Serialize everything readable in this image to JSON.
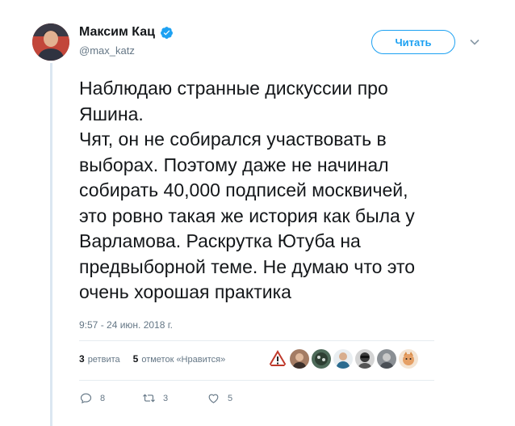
{
  "author": {
    "display_name": "Максим Кац",
    "handle": "@max_katz",
    "verified": true,
    "avatar_icon": "user-avatar-icon"
  },
  "follow_button": {
    "label": "Читать"
  },
  "tweet": {
    "lines": [
      "Наблюдаю странные дискуссии про",
      "Яшина.",
      "Чят, он не собирался участвовать в",
      "выборах. Поэтому даже не начинал",
      "собирать 40,000 подписей москвичей,",
      "это ровно такая же история как была у",
      "Варламова. Раскрутка Ютуба на",
      "предвыборной теме. Не думаю что это",
      "очень хорошая практика"
    ],
    "timestamp": "9:57 - 24 июн. 2018 г."
  },
  "stats": {
    "retweets_count": "3",
    "retweets_label": "ретвита",
    "likes_count": "5",
    "likes_label": "отметок «Нравится»"
  },
  "actions": {
    "reply_count": "8",
    "retweet_count": "3",
    "like_count": "5"
  },
  "colors": {
    "accent": "#1da1f2",
    "muted": "#657786",
    "text": "#14171a",
    "thread_line": "#dbe7f1"
  }
}
